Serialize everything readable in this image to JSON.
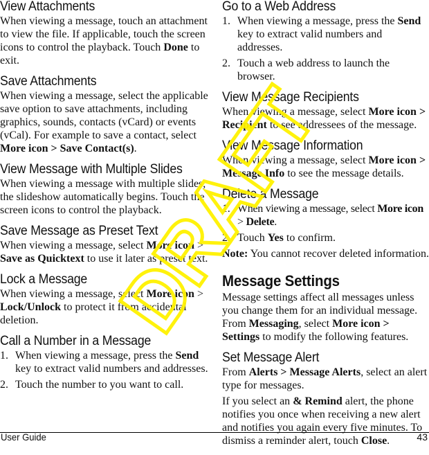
{
  "watermark": "DRAFT",
  "left_column": {
    "view_attachments": {
      "heading": "View Attachments",
      "text_1": "When viewing a message, touch an attachment to view the file. If applicable, touch the screen icons to control the playback. Touch ",
      "bold_1": "Done",
      "text_2": " to exit."
    },
    "save_attachments": {
      "heading": "Save Attachments",
      "text_1": "When viewing a message, select the applicable save option to save attachments, including graphics, sounds, contacts (vCard) or events (vCal). For example to save a contact, select ",
      "bold_1": "More icon > Save Contact(s)",
      "text_2": "."
    },
    "multiple_slides": {
      "heading": "View Message with Multiple Slides",
      "text_1": "When viewing a message with multiple slides, the slideshow automatically begins. Touch the screen icons to control the playback."
    },
    "preset_text": {
      "heading": "Save Message as Preset Text",
      "text_1": "When viewing a message, select ",
      "bold_1": "More icon",
      "text_2": " > ",
      "bold_2": "Save as Quicktext",
      "text_3": " to use it later as preset text."
    },
    "lock_message": {
      "heading": "Lock a Message",
      "text_1": "When viewing a message, select ",
      "bold_1": "More icon",
      "text_2": " > ",
      "bold_2": "Lock/Unlock",
      "text_3": " to protect it from accidental deletion."
    },
    "call_number": {
      "heading": "Call a Number in a Message",
      "steps": [
        {
          "num": "1.",
          "text_1": "When viewing a message, press the ",
          "bold_1": "Send",
          "text_2": " key to extract valid numbers and addresses."
        },
        {
          "num": "2.",
          "text_1": "Touch the number to you want to call."
        }
      ]
    }
  },
  "right_column": {
    "web_address": {
      "heading": "Go to a Web Address",
      "steps": [
        {
          "num": "1.",
          "text_1": "When viewing a message, press the ",
          "bold_1": "Send",
          "text_2": " key to extract valid numbers and addresses."
        },
        {
          "num": "2.",
          "text_1": "Touch a web address to launch the browser."
        }
      ]
    },
    "recipients": {
      "heading": "View Message Recipients",
      "text_1": "When viewing a message, select ",
      "bold_1": "More icon >",
      "text_2": " ",
      "bold_2": "Recipient",
      "text_3": " to see addressees of the message."
    },
    "information": {
      "heading": "View Message Information",
      "text_1": "When viewing a message, select ",
      "bold_1": "More icon >",
      "text_2": " ",
      "bold_2": "Message Info",
      "text_3": " to see the message details."
    },
    "delete_message": {
      "heading": "Delete a Message",
      "steps": [
        {
          "num": "1.",
          "text_1": "When viewing a message, select ",
          "bold_1": "More icon",
          "text_2": " > ",
          "bold_2": "Delete",
          "text_3": "."
        },
        {
          "num": "2.",
          "text_1": "Touch ",
          "bold_1": "Yes",
          "text_2": " to confirm."
        }
      ],
      "note_label": "Note:",
      "note_text": " You cannot recover deleted information."
    },
    "message_settings": {
      "heading": "Message Settings",
      "text_1": "Message settings affect all messages unless you change them for an individual message. From ",
      "bold_1": "Messaging",
      "text_2": ", select ",
      "bold_2": "More icon > Settings",
      "text_3": " to modify the following features."
    },
    "message_alert": {
      "heading": "Set Message Alert",
      "p1_text_1": "From ",
      "p1_bold_1": "Alerts > Message Alerts",
      "p1_text_2": ", select an alert type for messages.",
      "p2_text_1": "If you select an ",
      "p2_bold_1": "& Remind",
      "p2_text_2": " alert, the phone notifies you once when receiving a new alert and notifies you again every five minutes. To dismiss a reminder alert, touch ",
      "p2_bold_2": "Close",
      "p2_text_3": "."
    }
  },
  "footer": {
    "left": "User Guide",
    "page_number": "43"
  }
}
